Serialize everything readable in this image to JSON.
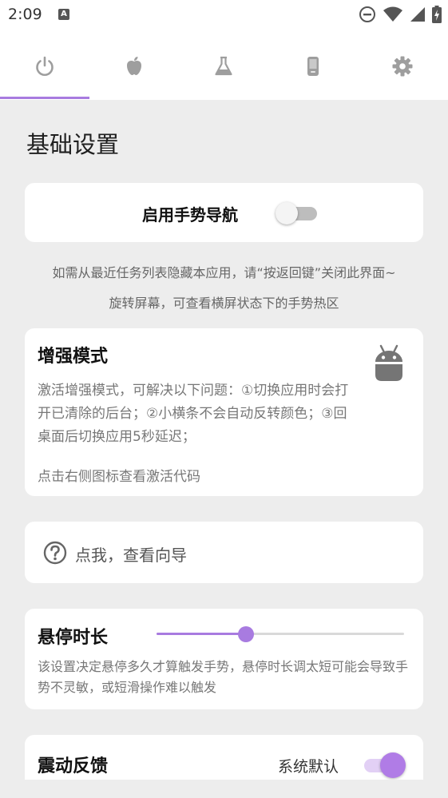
{
  "status_bar": {
    "time": "2:09",
    "notification_glyph": "A",
    "icons": [
      "do-not-disturb-icon",
      "wifi-icon",
      "signal-icon",
      "battery-charging-icon"
    ]
  },
  "tabs": [
    {
      "icon": "power-icon",
      "active": true
    },
    {
      "icon": "apple-icon",
      "active": false
    },
    {
      "icon": "flask-icon",
      "active": false
    },
    {
      "icon": "phone-icon",
      "active": false
    },
    {
      "icon": "gear-icon",
      "active": false
    }
  ],
  "colors": {
    "accent": "#a87be0",
    "background": "#ededed",
    "card": "#ffffff",
    "icon_inactive": "#9e9e9e"
  },
  "basic_settings": {
    "title": "基础设置",
    "gesture_toggle": {
      "label": "启用手势导航",
      "enabled": false
    },
    "hint_1": "如需从最近任务列表隐藏本应用，请“按返回键”关闭此界面~",
    "hint_2": "旋转屏幕，可查看横屏状态下的手势热区"
  },
  "enhanced_mode": {
    "title": "增强模式",
    "description": "激活增强模式，可解决以下问题：①切换应用时会打开已清除的后台；②小横条不会自动反转颜色；③回桌面后切换应用5秒延迟；",
    "tip": "点击右侧图标查看激活代码",
    "icon": "android-icon"
  },
  "guide": {
    "icon": "help-circle-icon",
    "label": "点我，查看向导"
  },
  "hover_duration": {
    "title": "悬停时长",
    "slider_fraction": 0.36,
    "description": "该设置决定悬停多久才算触发手势，悬停时长调太短可能会导致手势不灵敏，或短滑操作难以触发"
  },
  "vibration": {
    "title": "震动反馈",
    "value": "系统默认",
    "enabled": true
  }
}
